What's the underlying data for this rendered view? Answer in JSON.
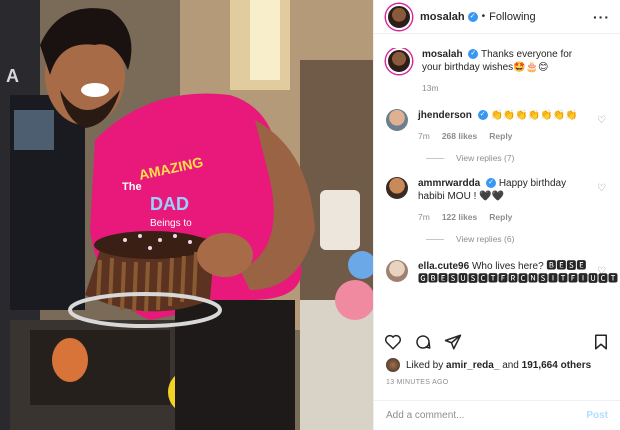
{
  "post": {
    "username": "mosalah",
    "follow_state": "Following",
    "caption_text": "Thanks everyone for your birthday wishes🤩🎂😊",
    "caption_time": "13m",
    "photo_text": {
      "shirt_line1": "The",
      "shirt_line2": "AMAZING",
      "shirt_line3": "DAD",
      "shirt_line4": "Beings to",
      "wall_letter": "A"
    }
  },
  "comments": [
    {
      "username": "jhenderson",
      "verified": true,
      "text": "👏👏👏👏👏👏👏",
      "time": "7m",
      "likes": "268 likes",
      "reply_label": "Reply",
      "view_replies": "View replies (7)"
    },
    {
      "username": "ammrwardda",
      "verified": true,
      "text": "Happy birthday habibi MOU ! 🖤🖤",
      "time": "7m",
      "likes": "122 likes",
      "reply_label": "Reply",
      "view_replies": "View replies (6)"
    },
    {
      "username": "ella.cute96",
      "verified": false,
      "text": "Who lives here? 🅱🅴🆂🅴 🅶🅱🅴🆂🆄🆂🅲🆃🅵🆁🅲🅽🆂🅸🆃🅵🅸🆄🅲🆃",
      "time": "",
      "likes": "",
      "reply_label": "",
      "view_replies": ""
    }
  ],
  "likes": {
    "prefix": "Liked by",
    "user": "amir_reda_",
    "and": "and",
    "count": "191,664 others"
  },
  "timestamp": "13 MINUTES AGO",
  "add_comment": {
    "placeholder": "Add a comment...",
    "post_label": "Post"
  },
  "icons": {
    "more": "more-icon",
    "heart": "heart-icon",
    "comment": "comment-icon",
    "share": "share-icon",
    "save": "bookmark-icon",
    "verified": "verified-badge-icon"
  },
  "colors": {
    "verified": "#3897f0",
    "shirt": "#e8197a",
    "link_disabled": "#b2dffc"
  }
}
